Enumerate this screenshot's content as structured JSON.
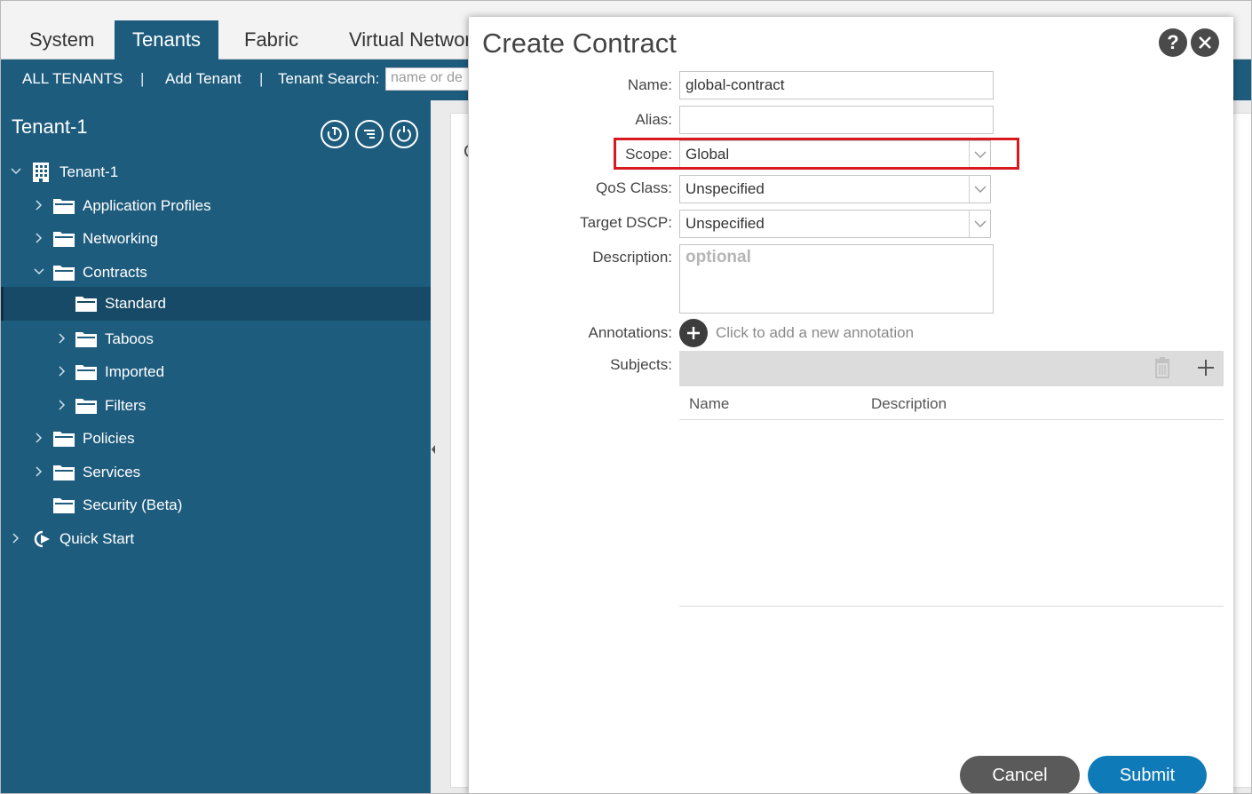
{
  "top_tabs": [
    {
      "label": "System"
    },
    {
      "label": "Tenants"
    },
    {
      "label": "Fabric"
    },
    {
      "label": "Virtual Networ"
    }
  ],
  "subnav": {
    "all_tenants": "ALL TENANTS",
    "sep": "|",
    "add_tenant": "Add Tenant",
    "search_label": "Tenant Search:",
    "search_placeholder": "name or de"
  },
  "sidebar": {
    "title": "Tenant-1",
    "tree": [
      {
        "label": "Tenant-1"
      },
      {
        "label": "Application Profiles"
      },
      {
        "label": "Networking"
      },
      {
        "label": "Contracts"
      },
      {
        "label": "Standard"
      },
      {
        "label": "Taboos"
      },
      {
        "label": "Imported"
      },
      {
        "label": "Filters"
      },
      {
        "label": "Policies"
      },
      {
        "label": "Services"
      },
      {
        "label": "Security (Beta)"
      },
      {
        "label": "Quick Start"
      }
    ]
  },
  "background": {
    "partial_title": "C"
  },
  "dialog": {
    "title": "Create Contract",
    "help_glyph": "?",
    "fields": {
      "name": {
        "label": "Name:",
        "value": "global-contract"
      },
      "alias": {
        "label": "Alias:",
        "value": ""
      },
      "scope": {
        "label": "Scope:",
        "value": "Global"
      },
      "qos": {
        "label": "QoS Class:",
        "value": "Unspecified"
      },
      "dscp": {
        "label": "Target DSCP:",
        "value": "Unspecified"
      },
      "description": {
        "label": "Description:",
        "placeholder": "optional"
      },
      "annotations": {
        "label": "Annotations:",
        "add_text": "Click to add a new annotation"
      },
      "subjects": {
        "label": "Subjects:",
        "columns": [
          "Name",
          "Description"
        ]
      }
    },
    "buttons": {
      "cancel": "Cancel",
      "submit": "Submit"
    }
  },
  "colors": {
    "nav_blue": "#1e5c7e",
    "selected_row": "#174a66",
    "submit_blue": "#0f7ab8",
    "cancel_gray": "#5a5a5a",
    "highlight_red": "#d71920"
  },
  "icons": {
    "sidebar_tools": [
      "clock-back-icon",
      "list-icon",
      "refresh-icon"
    ],
    "tree": [
      "building-icon",
      "folder-icon",
      "quick-start-icon"
    ],
    "dialog": [
      "help-icon",
      "close-icon",
      "add-icon",
      "trash-icon",
      "plus-icon"
    ]
  }
}
